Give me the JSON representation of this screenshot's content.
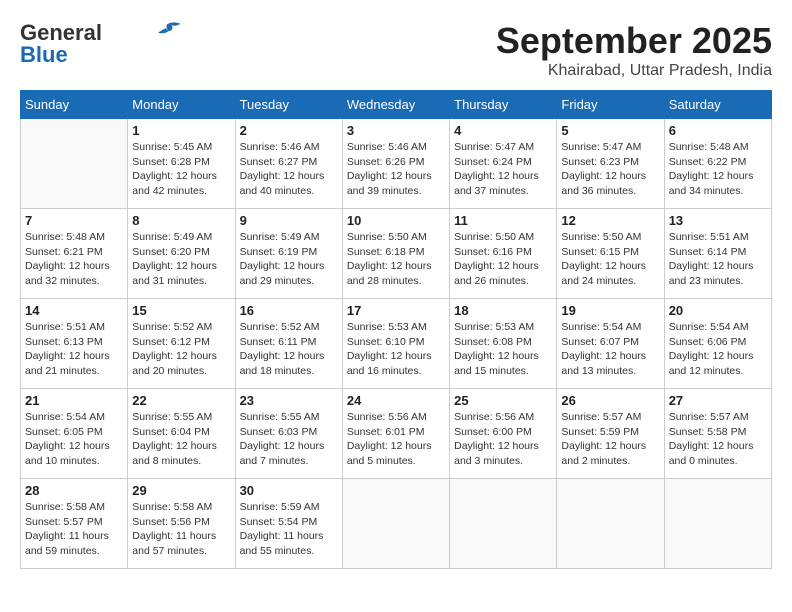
{
  "header": {
    "logo_line1": "General",
    "logo_line2": "Blue",
    "month": "September 2025",
    "location": "Khairabad, Uttar Pradesh, India"
  },
  "weekdays": [
    "Sunday",
    "Monday",
    "Tuesday",
    "Wednesday",
    "Thursday",
    "Friday",
    "Saturday"
  ],
  "weeks": [
    [
      {
        "day": "",
        "sunrise": "",
        "sunset": "",
        "daylight": ""
      },
      {
        "day": "1",
        "sunrise": "Sunrise: 5:45 AM",
        "sunset": "Sunset: 6:28 PM",
        "daylight": "Daylight: 12 hours and 42 minutes."
      },
      {
        "day": "2",
        "sunrise": "Sunrise: 5:46 AM",
        "sunset": "Sunset: 6:27 PM",
        "daylight": "Daylight: 12 hours and 40 minutes."
      },
      {
        "day": "3",
        "sunrise": "Sunrise: 5:46 AM",
        "sunset": "Sunset: 6:26 PM",
        "daylight": "Daylight: 12 hours and 39 minutes."
      },
      {
        "day": "4",
        "sunrise": "Sunrise: 5:47 AM",
        "sunset": "Sunset: 6:24 PM",
        "daylight": "Daylight: 12 hours and 37 minutes."
      },
      {
        "day": "5",
        "sunrise": "Sunrise: 5:47 AM",
        "sunset": "Sunset: 6:23 PM",
        "daylight": "Daylight: 12 hours and 36 minutes."
      },
      {
        "day": "6",
        "sunrise": "Sunrise: 5:48 AM",
        "sunset": "Sunset: 6:22 PM",
        "daylight": "Daylight: 12 hours and 34 minutes."
      }
    ],
    [
      {
        "day": "7",
        "sunrise": "Sunrise: 5:48 AM",
        "sunset": "Sunset: 6:21 PM",
        "daylight": "Daylight: 12 hours and 32 minutes."
      },
      {
        "day": "8",
        "sunrise": "Sunrise: 5:49 AM",
        "sunset": "Sunset: 6:20 PM",
        "daylight": "Daylight: 12 hours and 31 minutes."
      },
      {
        "day": "9",
        "sunrise": "Sunrise: 5:49 AM",
        "sunset": "Sunset: 6:19 PM",
        "daylight": "Daylight: 12 hours and 29 minutes."
      },
      {
        "day": "10",
        "sunrise": "Sunrise: 5:50 AM",
        "sunset": "Sunset: 6:18 PM",
        "daylight": "Daylight: 12 hours and 28 minutes."
      },
      {
        "day": "11",
        "sunrise": "Sunrise: 5:50 AM",
        "sunset": "Sunset: 6:16 PM",
        "daylight": "Daylight: 12 hours and 26 minutes."
      },
      {
        "day": "12",
        "sunrise": "Sunrise: 5:50 AM",
        "sunset": "Sunset: 6:15 PM",
        "daylight": "Daylight: 12 hours and 24 minutes."
      },
      {
        "day": "13",
        "sunrise": "Sunrise: 5:51 AM",
        "sunset": "Sunset: 6:14 PM",
        "daylight": "Daylight: 12 hours and 23 minutes."
      }
    ],
    [
      {
        "day": "14",
        "sunrise": "Sunrise: 5:51 AM",
        "sunset": "Sunset: 6:13 PM",
        "daylight": "Daylight: 12 hours and 21 minutes."
      },
      {
        "day": "15",
        "sunrise": "Sunrise: 5:52 AM",
        "sunset": "Sunset: 6:12 PM",
        "daylight": "Daylight: 12 hours and 20 minutes."
      },
      {
        "day": "16",
        "sunrise": "Sunrise: 5:52 AM",
        "sunset": "Sunset: 6:11 PM",
        "daylight": "Daylight: 12 hours and 18 minutes."
      },
      {
        "day": "17",
        "sunrise": "Sunrise: 5:53 AM",
        "sunset": "Sunset: 6:10 PM",
        "daylight": "Daylight: 12 hours and 16 minutes."
      },
      {
        "day": "18",
        "sunrise": "Sunrise: 5:53 AM",
        "sunset": "Sunset: 6:08 PM",
        "daylight": "Daylight: 12 hours and 15 minutes."
      },
      {
        "day": "19",
        "sunrise": "Sunrise: 5:54 AM",
        "sunset": "Sunset: 6:07 PM",
        "daylight": "Daylight: 12 hours and 13 minutes."
      },
      {
        "day": "20",
        "sunrise": "Sunrise: 5:54 AM",
        "sunset": "Sunset: 6:06 PM",
        "daylight": "Daylight: 12 hours and 12 minutes."
      }
    ],
    [
      {
        "day": "21",
        "sunrise": "Sunrise: 5:54 AM",
        "sunset": "Sunset: 6:05 PM",
        "daylight": "Daylight: 12 hours and 10 minutes."
      },
      {
        "day": "22",
        "sunrise": "Sunrise: 5:55 AM",
        "sunset": "Sunset: 6:04 PM",
        "daylight": "Daylight: 12 hours and 8 minutes."
      },
      {
        "day": "23",
        "sunrise": "Sunrise: 5:55 AM",
        "sunset": "Sunset: 6:03 PM",
        "daylight": "Daylight: 12 hours and 7 minutes."
      },
      {
        "day": "24",
        "sunrise": "Sunrise: 5:56 AM",
        "sunset": "Sunset: 6:01 PM",
        "daylight": "Daylight: 12 hours and 5 minutes."
      },
      {
        "day": "25",
        "sunrise": "Sunrise: 5:56 AM",
        "sunset": "Sunset: 6:00 PM",
        "daylight": "Daylight: 12 hours and 3 minutes."
      },
      {
        "day": "26",
        "sunrise": "Sunrise: 5:57 AM",
        "sunset": "Sunset: 5:59 PM",
        "daylight": "Daylight: 12 hours and 2 minutes."
      },
      {
        "day": "27",
        "sunrise": "Sunrise: 5:57 AM",
        "sunset": "Sunset: 5:58 PM",
        "daylight": "Daylight: 12 hours and 0 minutes."
      }
    ],
    [
      {
        "day": "28",
        "sunrise": "Sunrise: 5:58 AM",
        "sunset": "Sunset: 5:57 PM",
        "daylight": "Daylight: 11 hours and 59 minutes."
      },
      {
        "day": "29",
        "sunrise": "Sunrise: 5:58 AM",
        "sunset": "Sunset: 5:56 PM",
        "daylight": "Daylight: 11 hours and 57 minutes."
      },
      {
        "day": "30",
        "sunrise": "Sunrise: 5:59 AM",
        "sunset": "Sunset: 5:54 PM",
        "daylight": "Daylight: 11 hours and 55 minutes."
      },
      {
        "day": "",
        "sunrise": "",
        "sunset": "",
        "daylight": ""
      },
      {
        "day": "",
        "sunrise": "",
        "sunset": "",
        "daylight": ""
      },
      {
        "day": "",
        "sunrise": "",
        "sunset": "",
        "daylight": ""
      },
      {
        "day": "",
        "sunrise": "",
        "sunset": "",
        "daylight": ""
      }
    ]
  ]
}
